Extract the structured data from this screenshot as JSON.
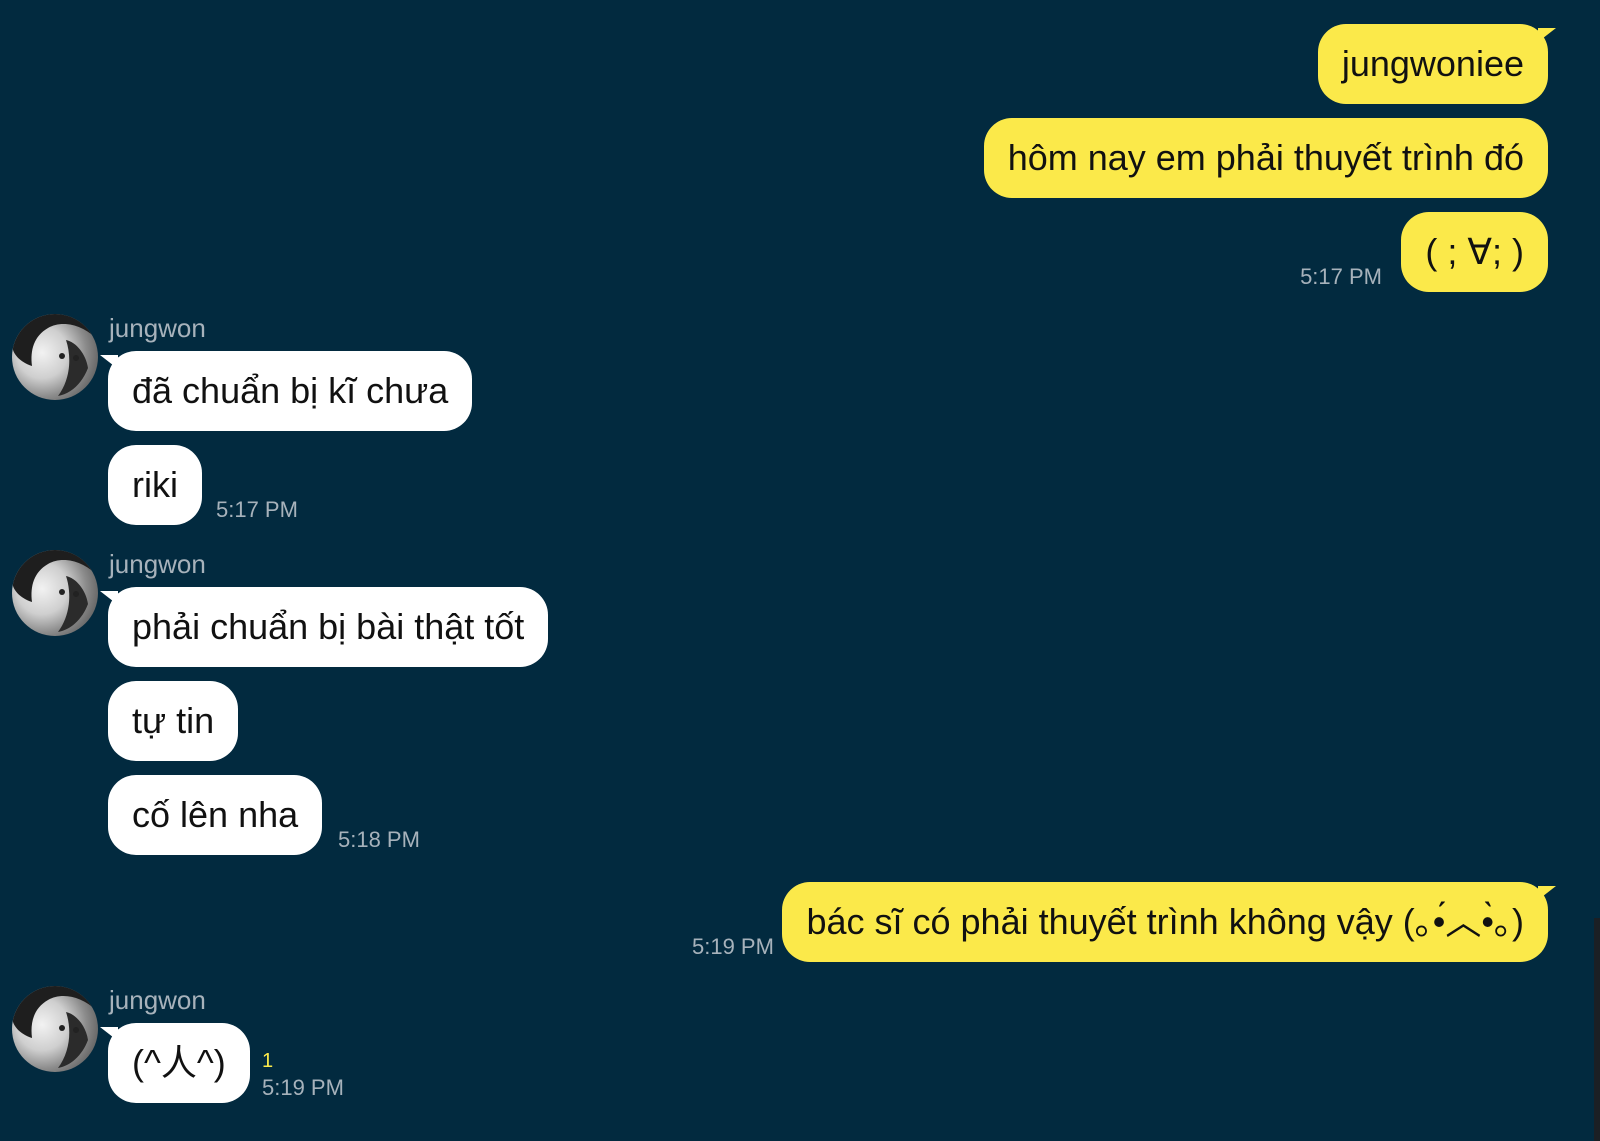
{
  "messages": [
    {
      "sender": "me",
      "text": "jungwoniee"
    },
    {
      "sender": "me",
      "text": "hôm nay em phải thuyết trình đó"
    },
    {
      "sender": "me",
      "text": "( ; ∀; )",
      "time": "5:17 PM"
    },
    {
      "sender": "other",
      "name": "jungwon",
      "text": "đã chuẩn bị kĩ chưa"
    },
    {
      "sender": "other",
      "text": "riki",
      "time": "5:17 PM"
    },
    {
      "sender": "other",
      "name": "jungwon",
      "text": "phải chuẩn bị bài thật tốt"
    },
    {
      "sender": "other",
      "text": "tự tin"
    },
    {
      "sender": "other",
      "text": "cố lên nha",
      "time": "5:18 PM"
    },
    {
      "sender": "me",
      "text": "bác sĩ có phải thuyết trình không vậy (｡•́︿•̀｡)",
      "time": "5:19 PM"
    },
    {
      "sender": "other",
      "name": "jungwon",
      "text": "(^人^)",
      "time": "5:19 PM",
      "unread": "1"
    }
  ],
  "colors": {
    "background": "#022a3f",
    "outgoing_bubble": "#fbe94a",
    "incoming_bubble": "#ffffff",
    "timestamp": "#a7b2bb",
    "unread_badge": "#fbe94a"
  },
  "icons": {
    "avatar": "profile-photo-avatar"
  }
}
